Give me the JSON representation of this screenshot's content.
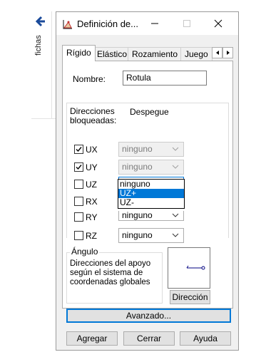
{
  "side_panel": {
    "label": "fichas"
  },
  "dialog": {
    "title": "Definición de...",
    "controls": {
      "minimize": "—",
      "close": "✕"
    },
    "tabs": [
      {
        "label": "Rígido",
        "active": true
      },
      {
        "label": "Elástico",
        "active": false
      },
      {
        "label": "Rozamiento",
        "active": false
      },
      {
        "label": "Juego",
        "active": false
      }
    ],
    "nombre": {
      "label": "Nombre:",
      "value": "Rotula"
    },
    "directions": {
      "header_blocked": "Direcciones bloqueadas:",
      "header_despegue": "Despegue",
      "rows": [
        {
          "label": "UX",
          "checked": true,
          "combo": "ninguno",
          "enabled": false
        },
        {
          "label": "UY",
          "checked": true,
          "combo": "ninguno",
          "enabled": false
        },
        {
          "label": "UZ",
          "checked": false,
          "combo": "ninguno",
          "enabled": true
        },
        {
          "label": "RX",
          "checked": false,
          "combo": "",
          "enabled": true
        },
        {
          "label": "RY",
          "checked": false,
          "combo": "ninguno",
          "enabled": true
        },
        {
          "label": "RZ",
          "checked": false,
          "combo": "ninguno",
          "enabled": true
        }
      ],
      "dropdown_options": [
        "ninguno",
        "UZ+",
        "UZ-"
      ],
      "dropdown_selected": "UZ+"
    },
    "angulo": {
      "label": "Ángulo",
      "description": "Direcciones del apoyo\nsegún el sistema de\ncoordenadas globales",
      "button": "Dirección"
    },
    "buttons": {
      "advanced": "Avanzado...",
      "add": "Agregar",
      "close": "Cerrar",
      "help": "Ayuda"
    },
    "colors": {
      "accent": "#0078d7",
      "dialog_bg": "#f0f0f0",
      "panel_bg": "#ffffff"
    }
  }
}
